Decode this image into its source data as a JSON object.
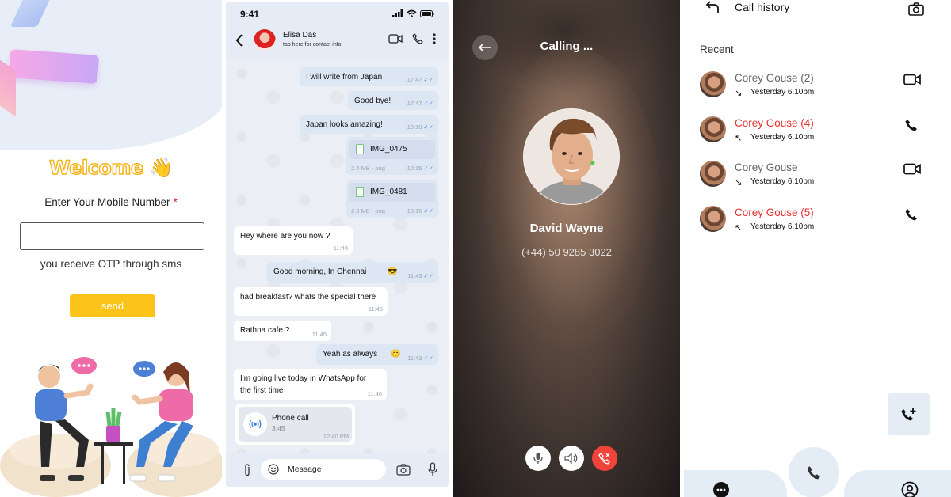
{
  "login": {
    "welcome": "Welcome",
    "wave_emoji": "👋",
    "enter_label": "Enter Your Mobile Number",
    "required_mark": "*",
    "mobile_value": "",
    "otp_note": "you receive OTP through sms",
    "send_label": "send",
    "accent_color": "#fcc419"
  },
  "chat": {
    "status_time": "9:41",
    "contact_name": "Elisa Das",
    "contact_sub": "tap here for contact info",
    "messages": [
      {
        "text": "I will write from Japan",
        "time": "17:47",
        "dir": "out"
      },
      {
        "text": "Good bye!",
        "time": "17:47",
        "dir": "out"
      },
      {
        "text": "Japan looks amazing!",
        "time": "10:10",
        "dir": "out"
      },
      {
        "file": "IMG_0475",
        "info": "2.4 MB - png",
        "time": "10:15",
        "dir": "out"
      },
      {
        "file": "IMG_0481",
        "info": "2.8 MB - png",
        "time": "10:15",
        "dir": "out"
      },
      {
        "text": "Hey where are you now ?",
        "time": "11:40",
        "dir": "in"
      },
      {
        "text": "Good morning, In Chennai",
        "emoji": "😎",
        "time": "11:43",
        "dir": "out"
      },
      {
        "text": "had breakfast? whats the special there",
        "time": "11:45",
        "dir": "in"
      },
      {
        "text": "Rathna cafe ?",
        "time": "11:45",
        "dir": "in"
      },
      {
        "text": "Yeah as always",
        "emoji": "😊",
        "time": "11:43",
        "dir": "out"
      },
      {
        "text": "I'm going live today in WhatsApp for",
        "text2": "the first time",
        "time": "11:40",
        "dir": "in"
      },
      {
        "call": "Phone call",
        "duration": "3:45",
        "time": "12:40 PM",
        "dir": "in"
      }
    ],
    "message_placeholder": "Message"
  },
  "calling": {
    "status": "Calling ...",
    "name": "David Wayne",
    "phone": "(+44) 50 9285 3022",
    "end_color": "#f0443a"
  },
  "history": {
    "title": "Call history",
    "recent_label": "Recent",
    "missed_color": "#e63232",
    "calls": [
      {
        "name": "Corey Gouse (2)",
        "time": "Yesterday 6.10pm",
        "missed": false,
        "direction": "outgoing",
        "type": "video-icon"
      },
      {
        "name": "Corey Gouse (4)",
        "time": "Yesterday 6.10pm",
        "missed": true,
        "direction": "incoming",
        "type": "phone-icon"
      },
      {
        "name": "Corey Gouse",
        "time": "Yesterday 6.10pm",
        "missed": false,
        "direction": "outgoing",
        "type": "video-icon"
      },
      {
        "name": "Corey Gouse (5)",
        "time": "Yesterday 6.10pm",
        "missed": true,
        "direction": "incoming",
        "type": "phone-icon"
      }
    ]
  }
}
